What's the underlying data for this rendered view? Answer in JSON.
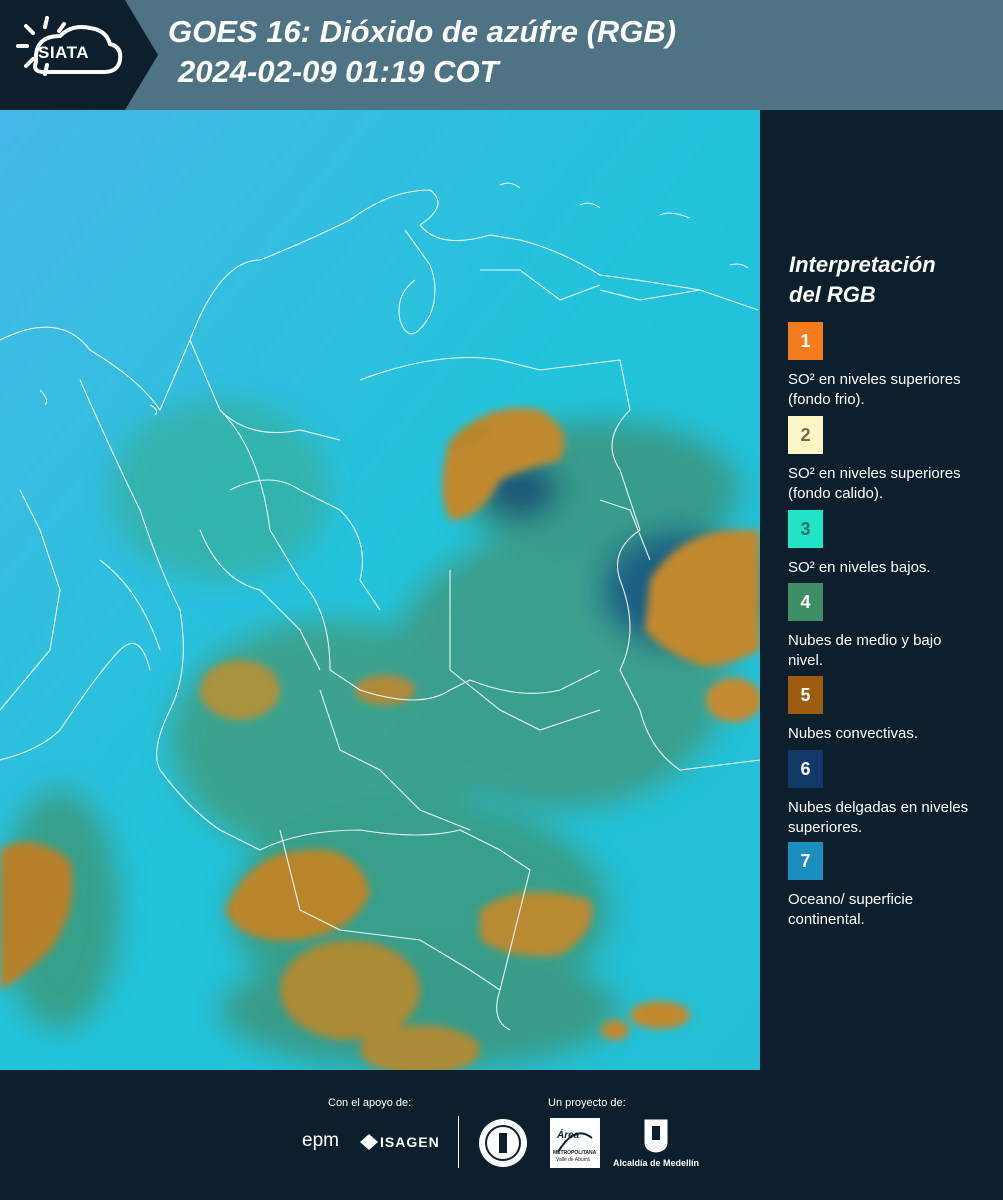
{
  "header": {
    "title": "GOES 16: Dióxido de azúfre (RGB)",
    "subtitle": "2024-02-09 01:19 COT",
    "logo_text": "SIATA"
  },
  "legend": {
    "title_line1": "Interpretación",
    "title_line2": "del RGB",
    "items": [
      {
        "number": "1",
        "color": "#f57c1c",
        "number_color": "#ffffff",
        "text": "SO² en niveles superiores (fondo frio)."
      },
      {
        "number": "2",
        "color": "#fdf5c3",
        "number_color": "#6b6b5a",
        "text": "SO² en niveles superiores (fondo calido)."
      },
      {
        "number": "3",
        "color": "#21e3c8",
        "number_color": "#2f6f6a",
        "text": "SO² en niveles bajos."
      },
      {
        "number": "4",
        "color": "#3f8e66",
        "number_color": "#ffffff",
        "text": "Nubes de medio y bajo nivel."
      },
      {
        "number": "5",
        "color": "#9c5d12",
        "number_color": "#ffffff",
        "text": "Nubes convectivas."
      },
      {
        "number": "6",
        "color": "#113a68",
        "number_color": "#ffffff",
        "text": "Nubes delgadas en niveles superiores."
      },
      {
        "number": "7",
        "color": "#1a8ebc",
        "number_color": "#ffffff",
        "text": "Oceano/ superficie continental."
      }
    ]
  },
  "footer": {
    "support_label": "Con el apoyo de:",
    "project_label": "Un proyecto de:",
    "logo_epm": "epm",
    "logo_isagen": "ISAGEN",
    "logo_area_line1": "Área",
    "logo_area_line2": "METROPOLITANA",
    "logo_area_line3": "Valle de Aburrá",
    "logo_alcaldia": "Alcaldía de Medellín"
  }
}
